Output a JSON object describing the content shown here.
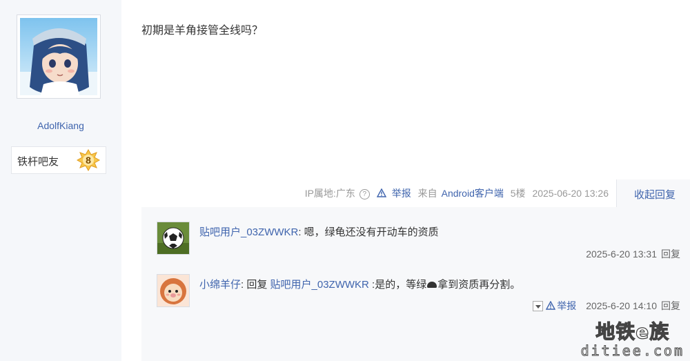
{
  "author": {
    "username": "AdolfKiang",
    "level_name": "铁杆吧友",
    "level_number": "8"
  },
  "post": {
    "content": "初期是羊角接管全线吗？",
    "ip_location": "IP属地:广东",
    "report_label": "举报",
    "source": "来自Android客户端",
    "floor": "5楼",
    "timestamp": "2025-06-20 13:26",
    "collapse_label": "收起回复"
  },
  "replies": [
    {
      "name": "贴吧用户_03ZWWKR",
      "separator": ":",
      "text": " 嗯，绿龟还没有开动车的资质",
      "timestamp": "2025-6-20 13:31",
      "reply_label": "回复"
    },
    {
      "name": "小绵羊仔",
      "separator": ": ",
      "reply_prefix": "回复 ",
      "reply_to": "贴吧用户_03ZWWKR",
      "text_before": " :是的，等绿",
      "text_after": "拿到资质再分割。",
      "report_label": "举报",
      "timestamp": "2025-6-20 14:10",
      "reply_label": "回复"
    }
  ],
  "watermark": {
    "line1": "地铁e族",
    "line2": "ditiee.com"
  },
  "colors": {
    "link": "#3f64ad",
    "sidebar_bg": "#f5f7fa",
    "reply_bg": "#f7f8fa",
    "meta_text": "#999999"
  }
}
